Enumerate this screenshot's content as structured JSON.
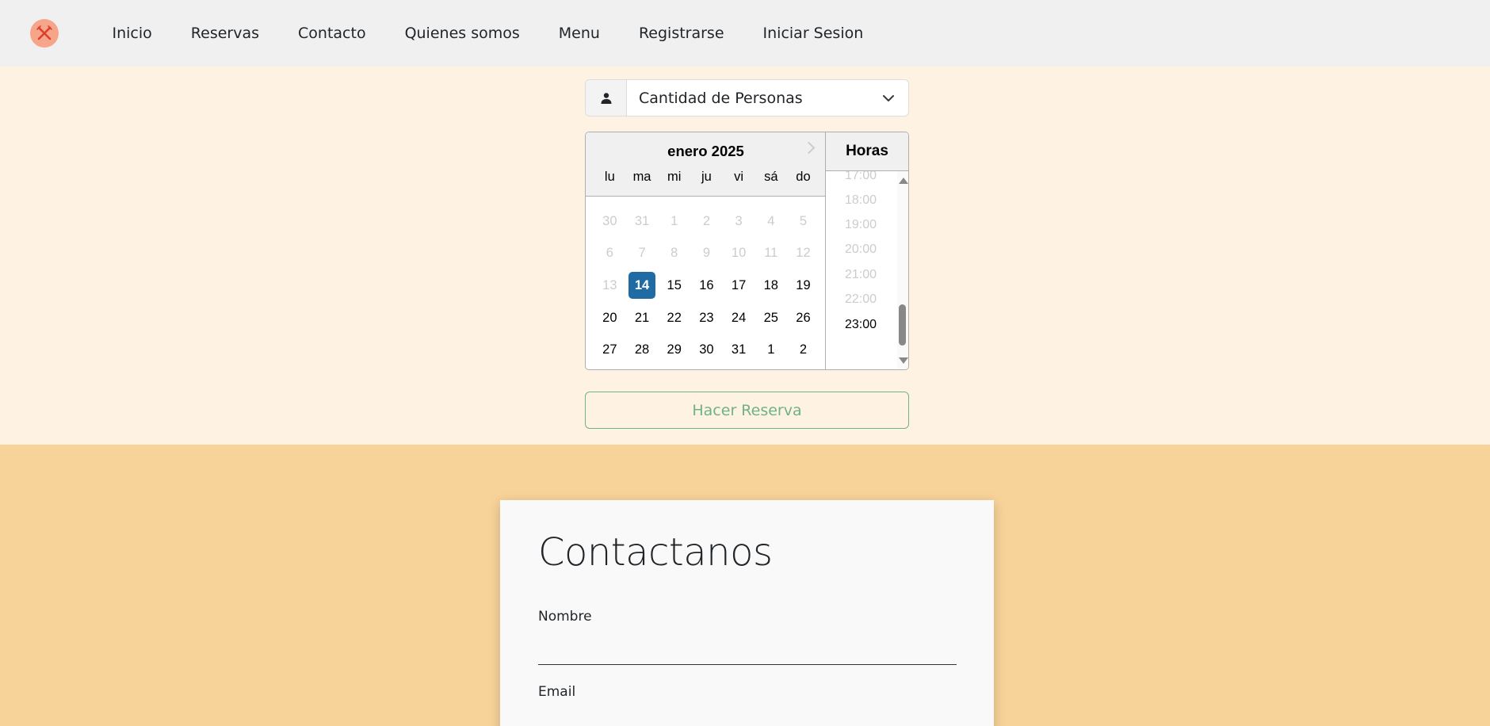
{
  "nav": {
    "logo_icon": "fork-knife-icon",
    "links": [
      "Inicio",
      "Reservas",
      "Contacto",
      "Quienes somos",
      "Menu",
      "Registrarse",
      "Iniciar Sesion"
    ]
  },
  "reservation": {
    "people_select": {
      "label": "Cantidad de Personas",
      "icon": "person-icon"
    },
    "datepicker": {
      "month_title": "enero 2025",
      "weekdays": [
        "lu",
        "ma",
        "mi",
        "ju",
        "vi",
        "sá",
        "do"
      ],
      "weeks": [
        [
          {
            "d": "30",
            "disabled": true
          },
          {
            "d": "31",
            "disabled": true
          },
          {
            "d": "1",
            "disabled": true
          },
          {
            "d": "2",
            "disabled": true
          },
          {
            "d": "3",
            "disabled": true
          },
          {
            "d": "4",
            "disabled": true
          },
          {
            "d": "5",
            "disabled": true
          }
        ],
        [
          {
            "d": "6",
            "disabled": true
          },
          {
            "d": "7",
            "disabled": true
          },
          {
            "d": "8",
            "disabled": true
          },
          {
            "d": "9",
            "disabled": true
          },
          {
            "d": "10",
            "disabled": true
          },
          {
            "d": "11",
            "disabled": true
          },
          {
            "d": "12",
            "disabled": true
          }
        ],
        [
          {
            "d": "13",
            "disabled": true
          },
          {
            "d": "14",
            "selected": true
          },
          {
            "d": "15"
          },
          {
            "d": "16"
          },
          {
            "d": "17"
          },
          {
            "d": "18"
          },
          {
            "d": "19"
          }
        ],
        [
          {
            "d": "20"
          },
          {
            "d": "21"
          },
          {
            "d": "22"
          },
          {
            "d": "23"
          },
          {
            "d": "24"
          },
          {
            "d": "25"
          },
          {
            "d": "26"
          }
        ],
        [
          {
            "d": "27"
          },
          {
            "d": "28"
          },
          {
            "d": "29"
          },
          {
            "d": "30"
          },
          {
            "d": "31"
          },
          {
            "d": "1"
          },
          {
            "d": "2"
          }
        ]
      ],
      "time_header": "Horas",
      "times": [
        {
          "t": "17:00",
          "disabled": true
        },
        {
          "t": "18:00",
          "disabled": true
        },
        {
          "t": "19:00",
          "disabled": true
        },
        {
          "t": "20:00",
          "disabled": true
        },
        {
          "t": "21:00",
          "disabled": true
        },
        {
          "t": "22:00",
          "disabled": true
        },
        {
          "t": "23:00",
          "disabled": false
        }
      ]
    },
    "button_label": "Hacer Reserva"
  },
  "contact": {
    "title": "Contactanos",
    "fields": [
      "Nombre",
      "Email"
    ]
  },
  "colors": {
    "navbar_bg": "#f0f0f0",
    "reserve_bg": "#fef3e2",
    "contact_bg": "#f7d299",
    "selected_day": "#216ba5",
    "button_green": "#6fb285",
    "logo_bg": "#f7a58a"
  }
}
